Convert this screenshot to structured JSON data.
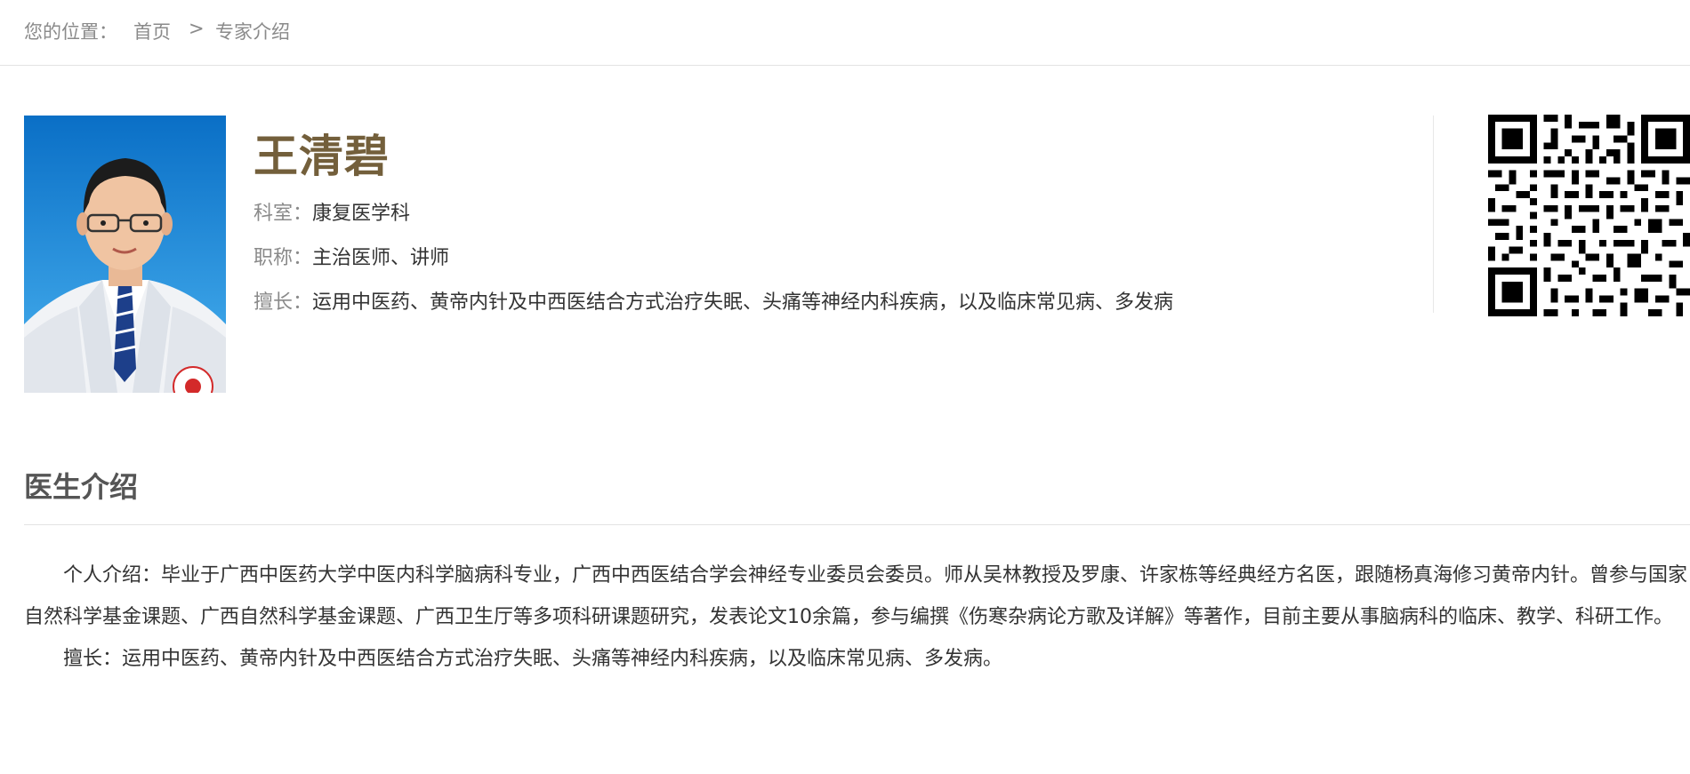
{
  "breadcrumb": {
    "prefix": "您的位置：",
    "home": "首页",
    "separator": ">",
    "current": "专家介绍"
  },
  "doctor": {
    "name": "王清碧",
    "photo_alt": "doctor-photo",
    "department_label": "科室：",
    "department": "康复医学科",
    "title_label": "职称：",
    "title": "主治医师、讲师",
    "specialty_label": "擅长：",
    "specialty": "运用中医药、黄帝内针及中西医结合方式治疗失眠、头痛等神经内科疾病，以及临床常见病、多发病"
  },
  "intro": {
    "heading": "医生介绍",
    "paragraph_1": "个人介绍：毕业于广西中医药大学中医内科学脑病科专业，广西中西医结合学会神经专业委员会委员。师从吴林教授及罗康、许家栋等经典经方名医，跟随杨真海修习黄帝内针。曾参与国家自然科学基金课题、广西自然科学基金课题、广西卫生厅等多项科研课题研究，发表论文10余篇，参与编撰《伤寒杂病论方歌及详解》等著作，目前主要从事脑病科的临床、教学、科研工作。",
    "paragraph_2": "擅长：运用中医药、黄帝内针及中西医结合方式治疗失眠、头痛等神经内科疾病，以及临床常见病、多发病。"
  },
  "colors": {
    "name_color": "#735f3b",
    "label_gray": "#8a8a8a",
    "text_dark": "#333333",
    "photo_bg_blue": "#1a8ee0"
  }
}
